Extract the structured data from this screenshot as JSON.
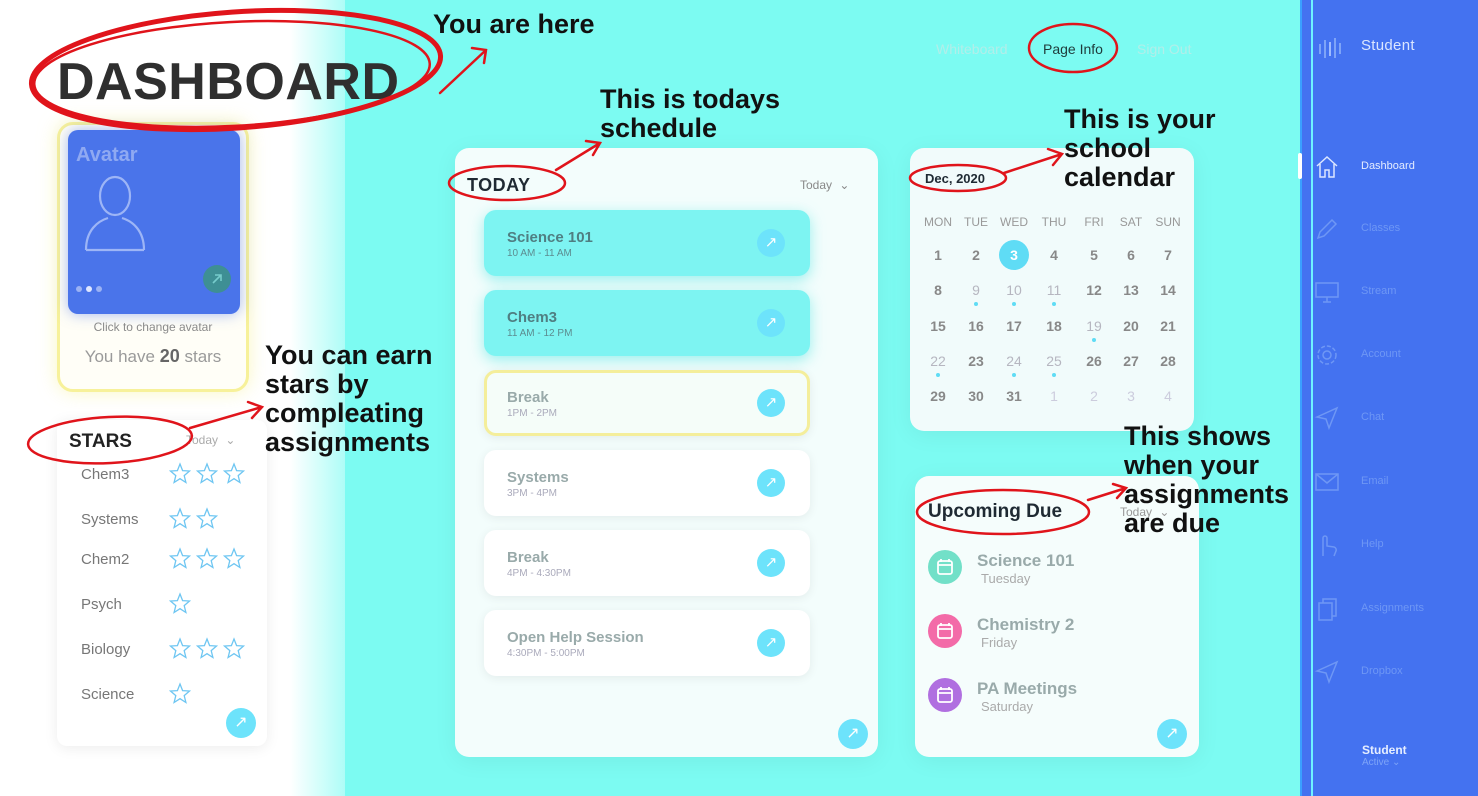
{
  "header": {
    "title": "DASHBOARD",
    "nav": [
      "Whiteboard",
      "Page Info",
      "Sign Out"
    ]
  },
  "annotations": {
    "you_are_here": "You are here",
    "schedule": [
      "This is todays",
      "schedule"
    ],
    "calendar": [
      "This is your",
      "school",
      "calendar"
    ],
    "stars": [
      "You can earn",
      "stars by",
      "compleating",
      "assignments"
    ],
    "due": [
      "This shows",
      "when your",
      "assignments",
      "are due"
    ]
  },
  "avatar": {
    "label": "Avatar",
    "change_text": "Click to change avatar",
    "stars_prefix": "You have",
    "stars_count": "20",
    "stars_suffix": "stars"
  },
  "stars": {
    "title": "STARS",
    "filter": "Today",
    "rows": [
      {
        "label": "Chem3",
        "stars": 3
      },
      {
        "label": "Systems",
        "stars": 2
      },
      {
        "label": "Chem2",
        "stars": 3
      },
      {
        "label": "Psych",
        "stars": 1
      },
      {
        "label": "Biology",
        "stars": 3
      },
      {
        "label": "Science",
        "stars": 1
      }
    ]
  },
  "schedule": {
    "title": "TODAY",
    "filter": "Today",
    "items": [
      {
        "name": "Science 101",
        "time": "10 AM - 11 AM"
      },
      {
        "name": "Chem3",
        "time": "11 AM - 12 PM"
      },
      {
        "name": "Break",
        "time": "1PM - 2PM"
      },
      {
        "name": "Systems",
        "time": "3PM - 4PM"
      },
      {
        "name": "Break",
        "time": "4PM - 4:30PM"
      },
      {
        "name": "Open Help Session",
        "time": "4:30PM - 5:00PM"
      }
    ]
  },
  "calendar": {
    "month": "Dec, 2020",
    "dow": [
      "MON",
      "TUE",
      "WED",
      "THU",
      "FRI",
      "SAT",
      "SUN"
    ],
    "weeks": [
      [
        "1",
        "2",
        "3",
        "4",
        "5",
        "6",
        "7"
      ],
      [
        "8",
        "9",
        "10",
        "11",
        "12",
        "13",
        "14"
      ],
      [
        "15",
        "16",
        "17",
        "18",
        "19",
        "20",
        "21"
      ],
      [
        "22",
        "23",
        "24",
        "25",
        "26",
        "27",
        "28"
      ],
      [
        "29",
        "30",
        "31",
        "1",
        "2",
        "3",
        "4"
      ]
    ]
  },
  "upcoming": {
    "title": "Upcoming Due",
    "filter": "Today",
    "items": [
      {
        "name": "Science 101",
        "day": "Tuesday",
        "color": "#72e0c8"
      },
      {
        "name": "Chemistry 2",
        "day": "Friday",
        "color": "#f36ba8"
      },
      {
        "name": "PA Meetings",
        "day": "Saturday",
        "color": "#b06fe0"
      }
    ]
  },
  "sidebar": {
    "title": "Student",
    "items": [
      {
        "label": "Dashboard",
        "icon": "home-icon"
      },
      {
        "label": "Classes",
        "icon": "pencil-icon"
      },
      {
        "label": "Stream",
        "icon": "monitor-icon"
      },
      {
        "label": "Account",
        "icon": "gear-icon"
      },
      {
        "label": "Chat",
        "icon": "send-icon"
      },
      {
        "label": "Email",
        "icon": "mail-icon"
      },
      {
        "label": "Help",
        "icon": "hand-icon"
      },
      {
        "label": "Assignments",
        "icon": "copy-icon"
      },
      {
        "label": "Dropbox",
        "icon": "send-icon"
      }
    ],
    "user_name": "Student",
    "user_status": "Active"
  },
  "colors": {
    "accent_cyan": "#7cfbf2",
    "sidebar_blue": "#4472f0",
    "annotation_red": "#e0141b"
  }
}
